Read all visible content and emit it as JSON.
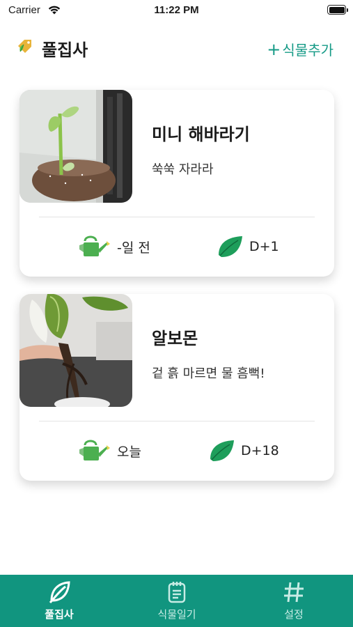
{
  "status_bar": {
    "carrier": "Carrier",
    "time": "11:22 PM"
  },
  "header": {
    "title": "풀집사",
    "add_plus": "+",
    "add_label": "식물추가"
  },
  "plants": [
    {
      "name": "미니 해바라기",
      "memo": "쑥쑥 자라라",
      "water": "-일 전",
      "days": "D+1"
    },
    {
      "name": "알보몬",
      "memo": "겉 흙 마르면 물 흠뻑!",
      "water": "오늘",
      "days": "D+18"
    }
  ],
  "tabs": [
    {
      "label": "풀집사",
      "icon": "leaf-icon"
    },
    {
      "label": "식물일기",
      "icon": "notepad-icon"
    },
    {
      "label": "설정",
      "icon": "hash-icon"
    }
  ],
  "colors": {
    "accent": "#11957f",
    "add_text": "#159a86",
    "leaf_green": "#1e9e5b",
    "can_green": "#4caf50"
  }
}
